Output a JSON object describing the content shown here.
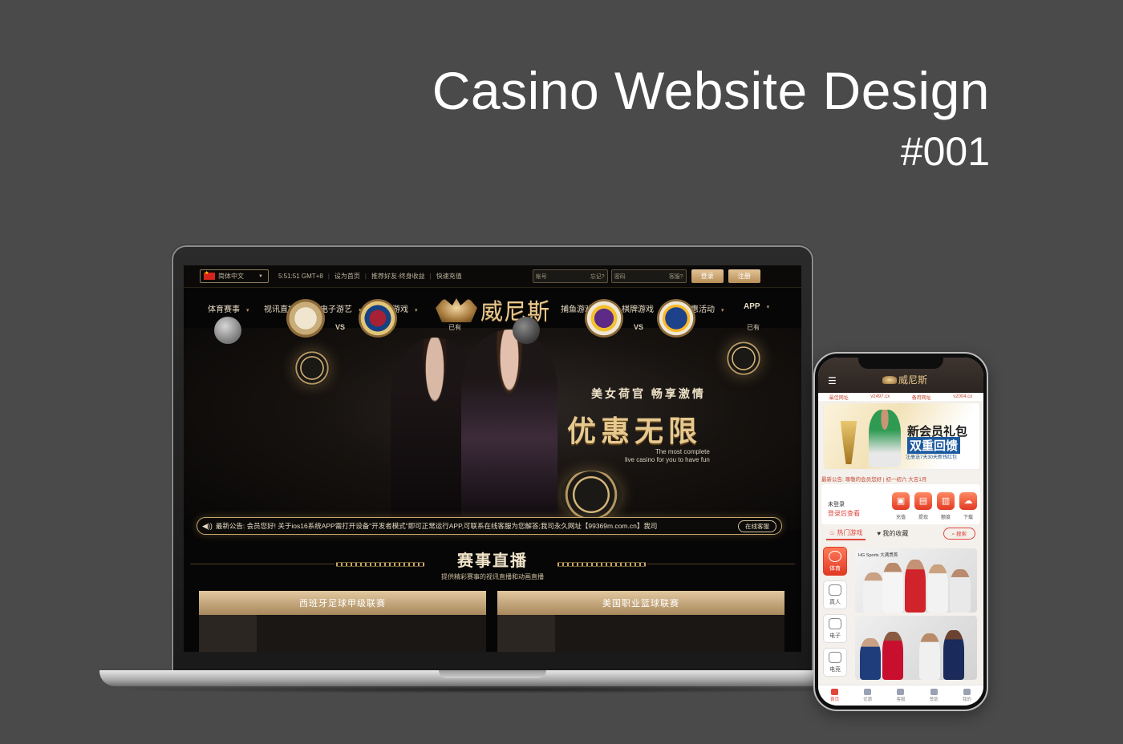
{
  "heading": {
    "title": "Casino Website Design",
    "number": "#001"
  },
  "desktop": {
    "topbar": {
      "language": "简体中文",
      "time": "5:51:51 GMT+8",
      "links": [
        "设为首页",
        "推荐好友·终身收益",
        "快速充值"
      ],
      "account_placeholder": "帐号",
      "account_hint": "忘记?",
      "password_placeholder": "密码",
      "password_hint": "客服?",
      "login": "登录",
      "register": "注册"
    },
    "nav": {
      "left": [
        "体育赛事",
        "视讯直播",
        "电子游艺",
        "彩票游戏"
      ],
      "right": [
        "捕鱼游戏",
        "棋牌游戏",
        "优惠活动",
        "APP"
      ],
      "logo": "威尼斯"
    },
    "hero": {
      "slogan1": "美女荷官  畅享激情",
      "slogan2": "优惠无限",
      "slogan3a": "The most complete",
      "slogan3b": "live casino for you to have fun"
    },
    "notice": {
      "text": "最新公告: 会员您好! 关于ios16系统APP需打开设备\"开发者模式\"即可正常运行APP,可联系在线客服为您解答;我司永久网址【99369m.com.cn】我司",
      "button": "在线客服"
    },
    "section": {
      "title": "赛事直播",
      "subtitle": "提供精彩赛事的视讯直播和动画直播"
    },
    "cards": [
      {
        "league": "西班牙足球甲级联赛",
        "vs": "VS",
        "status": "已有"
      },
      {
        "league": "美国职业篮球联赛",
        "vs": "VS",
        "status": "已有"
      }
    ]
  },
  "mobile": {
    "logo": "威尼斯",
    "links": [
      "最佳网址",
      "v2497.cx",
      "备用网址",
      "v2004.cx"
    ],
    "banner": {
      "line1": "新会员礼包",
      "line2": "双重回馈",
      "line3": "注册送7天30天新钱红包"
    },
    "notice": "最新公告: 尊敬的会员您好 | 初一初六 大吉1月",
    "user": {
      "name": "未登录",
      "action": "登录后查看"
    },
    "actions": [
      "充值",
      "提现",
      "额度",
      "下载"
    ],
    "tabs": {
      "hot": "热门游戏",
      "fav": "我的收藏",
      "search": "搜索"
    },
    "categories": [
      "体育",
      "真人",
      "电子",
      "电竞"
    ],
    "game_label": "HG Sports 大满贯首",
    "bottom": [
      "首页",
      "优惠",
      "客服",
      "赞助",
      "我的"
    ]
  },
  "colors": {
    "background": "#4a4a4a",
    "gold": "#c9a86a",
    "accent_red": "#e0473d"
  }
}
